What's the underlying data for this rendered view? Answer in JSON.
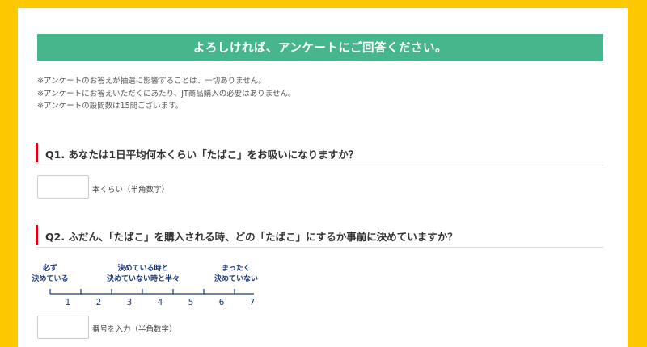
{
  "banner": {
    "title": "よろしければ、アンケートにご回答ください。"
  },
  "notes": [
    "※アンケートのお答えが抽選に影響することは、一切ありません。",
    "※アンケートにお答えいただくにあたり、JT商品購入の必要はありません。",
    "※アンケートの設問数は15問ございます。"
  ],
  "q1": {
    "question": "Q1. あなたは1日平均何本くらい「たばこ」をお吸いになりますか？",
    "value": "",
    "unit": "本くらい（半角数字）"
  },
  "q2": {
    "question": "Q2. ふだん、「たばこ」を購入される時、どの「たばこ」にするか事前に決めていますか？",
    "scale": {
      "left_label": "必ず\n決めている",
      "middle_label": "決めている時と\n決めていない時と半々",
      "right_label": "まったく\n決めていない",
      "ticks": [
        "1",
        "2",
        "3",
        "4",
        "5",
        "6",
        "7"
      ]
    },
    "value": "",
    "unit": "番号を入力（半角数字）"
  },
  "colors": {
    "page_bg": "#fcc800",
    "banner_bg": "#47b68c",
    "question_marker": "#d0021b",
    "scale_color": "#1a3a7a"
  }
}
